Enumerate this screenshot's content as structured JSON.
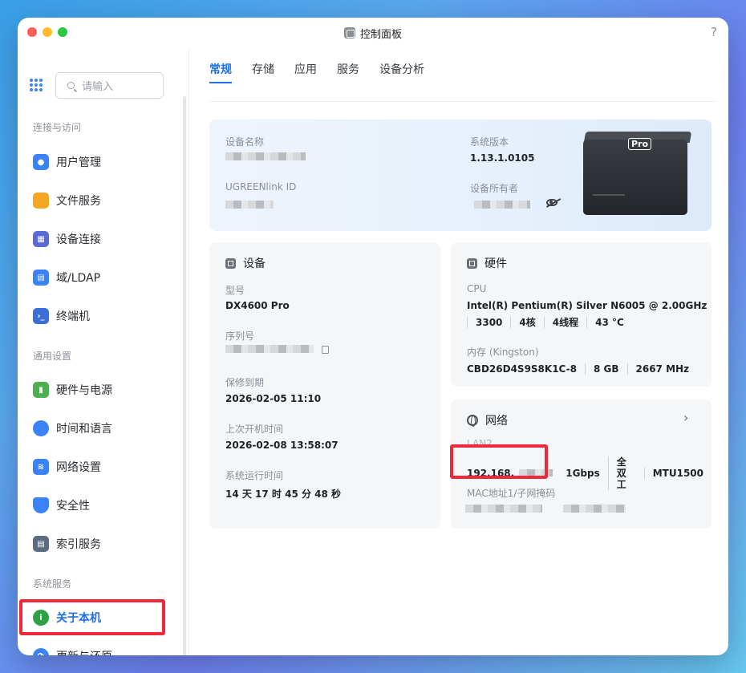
{
  "window": {
    "title": "控制面板",
    "help": "?"
  },
  "sidebar": {
    "search_placeholder": "请输入",
    "sections": [
      {
        "label": "连接与访问"
      },
      {
        "label": "通用设置"
      },
      {
        "label": "系统服务"
      }
    ],
    "items": [
      {
        "label": "用户管理",
        "icon": "user-icon",
        "color": "#3b82f6"
      },
      {
        "label": "文件服务",
        "icon": "folder-icon",
        "color": "#f5a623"
      },
      {
        "label": "设备连接",
        "icon": "device-icon",
        "color": "#5b6bd6"
      },
      {
        "label": "域/LDAP",
        "icon": "domain-icon",
        "color": "#3b82f6"
      },
      {
        "label": "终端机",
        "icon": "terminal-icon",
        "color": "#3b6fd6"
      },
      {
        "label": "硬件与电源",
        "icon": "power-icon",
        "color": "#4caf50"
      },
      {
        "label": "时间和语言",
        "icon": "globe-time-icon",
        "color": "#3b82f6"
      },
      {
        "label": "网络设置",
        "icon": "network-icon",
        "color": "#3b82f6"
      },
      {
        "label": "安全性",
        "icon": "shield-icon",
        "color": "#3b82f6"
      },
      {
        "label": "索引服务",
        "icon": "index-icon",
        "color": "#5b6b80"
      },
      {
        "label": "关于本机",
        "icon": "info-icon",
        "color": "#2ea043"
      },
      {
        "label": "更新与还原",
        "icon": "refresh-icon",
        "color": "#3b82f6"
      }
    ]
  },
  "tabs": [
    "常规",
    "存储",
    "应用",
    "服务",
    "设备分析"
  ],
  "hero": {
    "device_name_label": "设备名称",
    "ugreen_id_label": "UGREENlink ID",
    "sys_version_label": "系统版本",
    "sys_version": "1.13.1.0105",
    "owner_label": "设备所有者",
    "device_badge": "Pro"
  },
  "device_card": {
    "title": "设备",
    "model_label": "型号",
    "model": "DX4600 Pro",
    "serial_label": "序列号",
    "warranty_label": "保修到期",
    "warranty": "2026-02-05 11:10",
    "last_boot_label": "上次开机时间",
    "last_boot": "2026-02-08 13:58:07",
    "uptime_label": "系统运行时间",
    "uptime": "14 天 17 时 45 分 48 秒"
  },
  "hardware_card": {
    "title": "硬件",
    "cpu_label": "CPU",
    "cpu": "Intel(R) Pentium(R) Silver N6005 @ 2.00GHz",
    "cpu_specs": [
      "3300",
      "4核",
      "4线程",
      "43 °C"
    ],
    "mem_label": "内存 (Kingston)",
    "mem_specs": [
      "CBD26D4S9S8K1C-8",
      "8 GB",
      "2667 MHz"
    ]
  },
  "network_card": {
    "title": "网络",
    "lan_label": "LAN2",
    "ip_prefix": "192.168.",
    "net_specs": [
      "1Gbps",
      "全双工",
      "MTU1500"
    ],
    "mac_label": "MAC地址1/子网掩码"
  }
}
